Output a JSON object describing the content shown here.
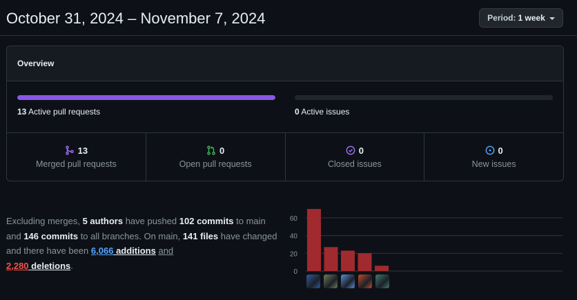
{
  "header": {
    "date_range": "October 31, 2024 – November 7, 2024",
    "period_label": "Period:",
    "period_value": "1 week"
  },
  "overview": {
    "title": "Overview",
    "pull_requests": {
      "count": "13",
      "label": "Active pull requests",
      "fill": 1.0,
      "color": "#8957e5"
    },
    "issues": {
      "count": "0",
      "label": "Active issues",
      "fill": 0.0,
      "color": "#238636"
    }
  },
  "stats": [
    {
      "icon": "merged-pr-icon",
      "value": "13",
      "label": "Merged pull requests",
      "color": "#a371f7"
    },
    {
      "icon": "open-pr-icon",
      "value": "0",
      "label": "Open pull requests",
      "color": "#3fb950"
    },
    {
      "icon": "closed-issue-icon",
      "value": "0",
      "label": "Closed issues",
      "color": "#a371f7"
    },
    {
      "icon": "new-issue-icon",
      "value": "0",
      "label": "New issues",
      "color": "#3fb950"
    }
  ],
  "summary": {
    "p1": "Excluding merges, ",
    "authors": "5 authors",
    "p2": " have pushed ",
    "commits_main": "102 commits",
    "p3": " to main and ",
    "commits_all": "146 commits",
    "p4": " to all branches. On main, ",
    "files": "141 files",
    "p5": " have changed and there have been ",
    "additions_num": "6,066",
    "additions_word": "additions",
    "p6": "and",
    "deletions_num": "2,280",
    "deletions_word": "deletions",
    "p7": "."
  },
  "chart_data": {
    "type": "bar",
    "categories": [
      "author-1",
      "author-2",
      "author-3",
      "author-4",
      "author-5"
    ],
    "values": [
      70,
      27,
      23,
      20,
      6
    ],
    "ylim": [
      0,
      70
    ],
    "yticks": [
      0,
      20,
      40,
      60
    ],
    "color": "#a02a2e",
    "grid": true
  },
  "avatars": [
    {
      "name": "avatar-1",
      "color": "#2f5a9e"
    },
    {
      "name": "avatar-2",
      "color": "#6e7a5a"
    },
    {
      "name": "avatar-3",
      "color": "#5b8ed6"
    },
    {
      "name": "avatar-4",
      "color": "#c14a2a"
    },
    {
      "name": "avatar-5",
      "color": "#3e7a6a"
    }
  ]
}
